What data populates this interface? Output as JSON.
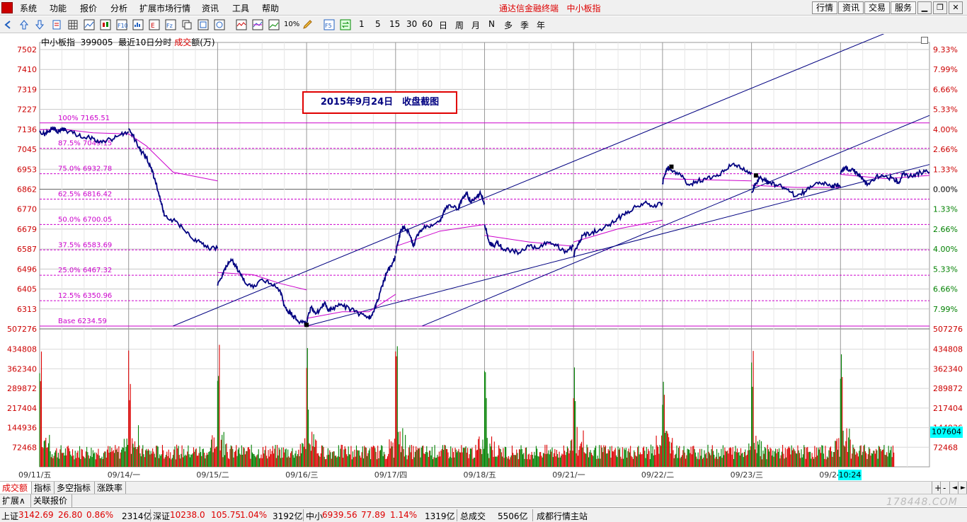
{
  "menu": {
    "items": [
      "系统",
      "功能",
      "报价",
      "分析",
      "扩展市场行情",
      "资讯",
      "工具",
      "帮助"
    ],
    "title": "通达信金融终端",
    "title_index": "中小板指",
    "right_buttons": [
      "行情",
      "资讯",
      "交易",
      "服务"
    ]
  },
  "toolbar": {
    "text_buttons": [
      "1",
      "5",
      "15",
      "30",
      "60",
      "日",
      "周",
      "月",
      "N",
      "多",
      "季",
      "年"
    ],
    "pct_label": "10%"
  },
  "chart": {
    "name": "中小板指",
    "code": "399005",
    "period": "最近10日分时",
    "volume_label_red": "成交",
    "volume_label_rest": "额(万)",
    "annotation": "2015年9月24日　收盘截图",
    "current_volume": "107604",
    "current_time": "10:24"
  },
  "tabs": [
    "成交额",
    "指标",
    "多空指标",
    "涨跌率"
  ],
  "tabs_right": [
    "+",
    "-",
    "◄",
    "►"
  ],
  "row2": [
    "扩展∧",
    "关联报价"
  ],
  "status": {
    "sh_label": "上证",
    "sh_value": "3142.69",
    "sh_change": "26.80",
    "sh_pct": "0.86%",
    "sh_amount": "2314亿",
    "sz_label": "深证",
    "sz_value": "10238.0",
    "sz_change": "105.75",
    "sz_pct": "1.04%",
    "sz_amount": "3192亿",
    "zx_label": "中小",
    "zx_value": "6939.56",
    "zx_change": "77.89",
    "zx_pct": "1.14%",
    "zx_amount": "1319亿",
    "total_label": "总成交",
    "total_amount": "5506亿",
    "station": "成都行情主站"
  },
  "watermark": "178448.COM",
  "colors": {
    "price": "#000080",
    "avg": "#cc00cc",
    "up": "#dd0000",
    "down": "#008000",
    "axis_text": "#cc0000",
    "fib": "#cc00cc",
    "channel": "#000080"
  },
  "chart_data": {
    "type": "line",
    "price_axis": [
      "7502",
      "7410",
      "7319",
      "7227",
      "7136",
      "7045",
      "6953",
      "6862",
      "6770",
      "6679",
      "6587",
      "6496",
      "6405",
      "6313"
    ],
    "pct_axis": [
      "9.33%",
      "7.99%",
      "6.66%",
      "5.33%",
      "4.00%",
      "2.66%",
      "1.33%",
      "0.00%",
      "1.33%",
      "2.66%",
      "4.00%",
      "5.33%",
      "6.66%",
      "7.99%"
    ],
    "price_base": "507276",
    "volume_axis": [
      "434808",
      "362340",
      "289872",
      "217404",
      "144936",
      "72468"
    ],
    "dates": [
      "09/11/五",
      "09/14/一",
      "09/15/二",
      "09/16/三",
      "09/17/四",
      "09/18/五",
      "09/21/一",
      "09/22/二",
      "09/23/三",
      "09/24/四"
    ],
    "fib_levels": [
      {
        "label": "100% 7165.51",
        "value": 7165.51
      },
      {
        "label": "87.5% 7049.15",
        "value": 7049.15
      },
      {
        "label": "75.0% 6932.78",
        "value": 6932.78
      },
      {
        "label": "62.5% 6816.42",
        "value": 6816.42
      },
      {
        "label": "50.0% 6700.05",
        "value": 6700.05
      },
      {
        "label": "37.5% 6583.69",
        "value": 6583.69
      },
      {
        "label": "25.0% 6467.32",
        "value": 6467.32
      },
      {
        "label": "12.5% 6350.96",
        "value": 6350.96
      },
      {
        "label": "Base 6234.59",
        "value": 6234.59
      }
    ],
    "prev_close": 6862,
    "price_path": [
      [
        0,
        7130
      ],
      [
        0.05,
        7115
      ],
      [
        0.1,
        7125
      ],
      [
        0.15,
        7145
      ],
      [
        0.2,
        7120
      ],
      [
        0.25,
        7140
      ],
      [
        0.3,
        7130
      ],
      [
        0.4,
        7115
      ],
      [
        0.5,
        7100
      ],
      [
        0.6,
        7095
      ],
      [
        0.7,
        7075
      ],
      [
        0.8,
        7090
      ],
      [
        0.9,
        7110
      ],
      [
        1.0,
        7125
      ],
      [
        1.0,
        7140
      ],
      [
        1.05,
        7110
      ],
      [
        1.1,
        7060
      ],
      [
        1.15,
        7030
      ],
      [
        1.2,
        7010
      ],
      [
        1.25,
        6960
      ],
      [
        1.3,
        6900
      ],
      [
        1.35,
        6830
      ],
      [
        1.4,
        6740
      ],
      [
        1.5,
        6720
      ],
      [
        1.6,
        6690
      ],
      [
        1.7,
        6640
      ],
      [
        1.8,
        6620
      ],
      [
        1.9,
        6590
      ],
      [
        2.0,
        6590
      ],
      [
        2.0,
        6420
      ],
      [
        2.05,
        6460
      ],
      [
        2.1,
        6510
      ],
      [
        2.15,
        6540
      ],
      [
        2.2,
        6510
      ],
      [
        2.25,
        6480
      ],
      [
        2.3,
        6440
      ],
      [
        2.4,
        6410
      ],
      [
        2.5,
        6450
      ],
      [
        2.6,
        6430
      ],
      [
        2.7,
        6400
      ],
      [
        2.75,
        6330
      ],
      [
        2.8,
        6300
      ],
      [
        2.85,
        6280
      ],
      [
        2.9,
        6260
      ],
      [
        2.95,
        6250
      ],
      [
        3.0,
        6240
      ],
      [
        3.0,
        6250
      ],
      [
        3.05,
        6320
      ],
      [
        3.1,
        6290
      ],
      [
        3.15,
        6310
      ],
      [
        3.2,
        6340
      ],
      [
        3.25,
        6300
      ],
      [
        3.3,
        6320
      ],
      [
        3.4,
        6330
      ],
      [
        3.5,
        6310
      ],
      [
        3.6,
        6290
      ],
      [
        3.7,
        6270
      ],
      [
        3.75,
        6300
      ],
      [
        3.8,
        6350
      ],
      [
        3.85,
        6420
      ],
      [
        3.9,
        6480
      ],
      [
        3.95,
        6510
      ],
      [
        4.0,
        6550
      ],
      [
        4.0,
        6570
      ],
      [
        4.03,
        6620
      ],
      [
        4.06,
        6680
      ],
      [
        4.1,
        6690
      ],
      [
        4.15,
        6660
      ],
      [
        4.2,
        6600
      ],
      [
        4.25,
        6650
      ],
      [
        4.3,
        6680
      ],
      [
        4.4,
        6700
      ],
      [
        4.5,
        6720
      ],
      [
        4.55,
        6760
      ],
      [
        4.6,
        6790
      ],
      [
        4.7,
        6770
      ],
      [
        4.75,
        6820
      ],
      [
        4.8,
        6840
      ],
      [
        4.85,
        6800
      ],
      [
        4.9,
        6820
      ],
      [
        4.95,
        6850
      ],
      [
        5.0,
        6800
      ],
      [
        5.0,
        6700
      ],
      [
        5.05,
        6620
      ],
      [
        5.1,
        6600
      ],
      [
        5.15,
        6620
      ],
      [
        5.2,
        6590
      ],
      [
        5.3,
        6580
      ],
      [
        5.4,
        6570
      ],
      [
        5.5,
        6600
      ],
      [
        5.6,
        6590
      ],
      [
        5.7,
        6620
      ],
      [
        5.8,
        6610
      ],
      [
        5.9,
        6570
      ],
      [
        6.0,
        6600
      ],
      [
        6.0,
        6560
      ],
      [
        6.05,
        6610
      ],
      [
        6.1,
        6650
      ],
      [
        6.2,
        6660
      ],
      [
        6.3,
        6680
      ],
      [
        6.4,
        6700
      ],
      [
        6.5,
        6730
      ],
      [
        6.6,
        6750
      ],
      [
        6.7,
        6780
      ],
      [
        6.8,
        6800
      ],
      [
        6.9,
        6780
      ],
      [
        7.0,
        6800
      ],
      [
        7.0,
        6890
      ],
      [
        7.03,
        6930
      ],
      [
        7.06,
        6960
      ],
      [
        7.1,
        6950
      ],
      [
        7.2,
        6930
      ],
      [
        7.3,
        6880
      ],
      [
        7.4,
        6900
      ],
      [
        7.5,
        6910
      ],
      [
        7.6,
        6920
      ],
      [
        7.7,
        6950
      ],
      [
        7.8,
        6980
      ],
      [
        7.9,
        6950
      ],
      [
        8.0,
        6940
      ],
      [
        8.0,
        6850
      ],
      [
        8.05,
        6890
      ],
      [
        8.1,
        6920
      ],
      [
        8.15,
        6900
      ],
      [
        8.2,
        6890
      ],
      [
        8.3,
        6880
      ],
      [
        8.4,
        6860
      ],
      [
        8.5,
        6830
      ],
      [
        8.6,
        6850
      ],
      [
        8.7,
        6880
      ],
      [
        8.8,
        6890
      ],
      [
        8.9,
        6870
      ],
      [
        8.95,
        6880
      ],
      [
        9.0,
        6870
      ],
      [
        9.0,
        6930
      ],
      [
        9.05,
        6960
      ],
      [
        9.1,
        6950
      ],
      [
        9.15,
        6945
      ],
      [
        9.2,
        6930
      ],
      [
        9.25,
        6910
      ],
      [
        9.3,
        6880
      ],
      [
        9.4,
        6920
      ],
      [
        9.5,
        6920
      ],
      [
        9.6,
        6910
      ],
      [
        9.65,
        6890
      ],
      [
        9.7,
        6930
      ],
      [
        9.8,
        6920
      ],
      [
        9.9,
        6940
      ],
      [
        10.0,
        6940
      ]
    ],
    "avg_path": [
      [
        0,
        7135
      ],
      [
        0.3,
        7135
      ],
      [
        0.6,
        7120
      ],
      [
        1.0,
        7115
      ],
      [
        1.2,
        7060
      ],
      [
        1.5,
        6940
      ],
      [
        2.0,
        6900
      ],
      [
        2.0,
        6480
      ],
      [
        2.4,
        6470
      ],
      [
        2.7,
        6430
      ],
      [
        3.0,
        6400
      ],
      [
        3.0,
        6270
      ],
      [
        3.4,
        6300
      ],
      [
        3.7,
        6300
      ],
      [
        4.0,
        6380
      ],
      [
        4.0,
        6600
      ],
      [
        4.5,
        6670
      ],
      [
        5.0,
        6700
      ],
      [
        5.0,
        6650
      ],
      [
        5.5,
        6620
      ],
      [
        6.0,
        6600
      ],
      [
        6.0,
        6620
      ],
      [
        6.5,
        6680
      ],
      [
        7.0,
        6720
      ],
      [
        7.0,
        6910
      ],
      [
        7.5,
        6905
      ],
      [
        8.0,
        6900
      ],
      [
        8.0,
        6880
      ],
      [
        8.5,
        6870
      ],
      [
        9.0,
        6870
      ],
      [
        9.0,
        6930
      ],
      [
        9.5,
        6910
      ],
      [
        10.0,
        6925
      ]
    ],
    "channel_lines": [
      [
        [
          1.5,
          6235
        ],
        [
          10.0,
          7660
        ]
      ],
      [
        [
          4.3,
          6235
        ],
        [
          10.0,
          7200
        ]
      ],
      [
        [
          3.0,
          6235
        ],
        [
          10.0,
          6975
        ]
      ]
    ]
  }
}
